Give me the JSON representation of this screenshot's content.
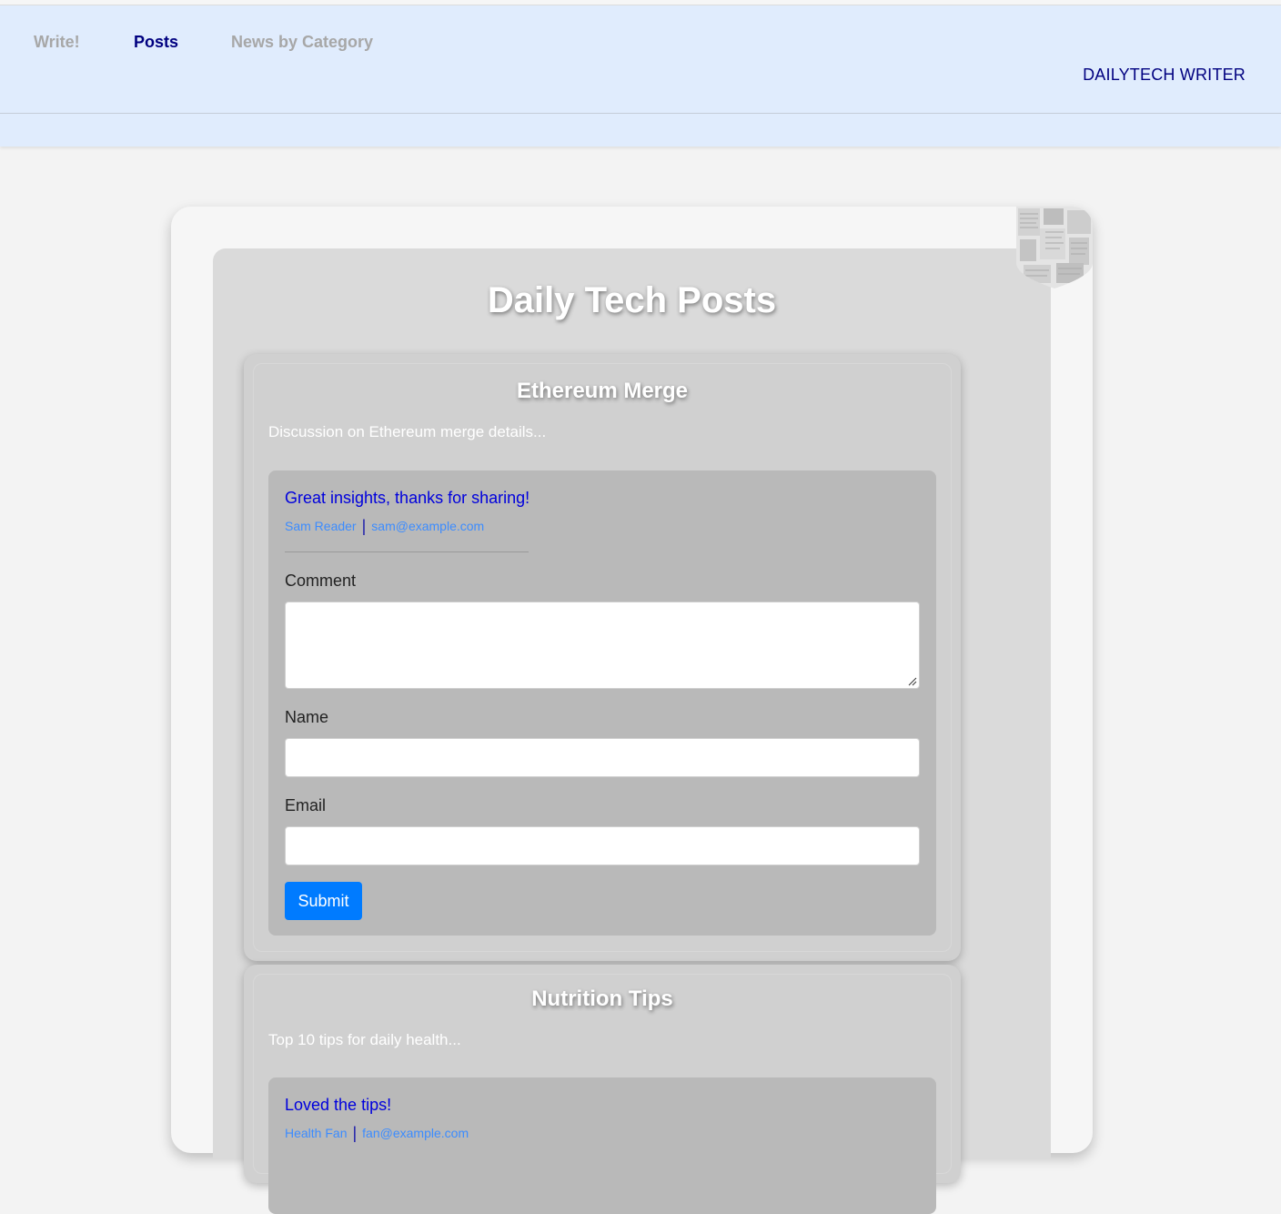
{
  "nav": {
    "links": [
      {
        "label": "Write!",
        "active": false
      },
      {
        "label": "Posts",
        "active": true
      },
      {
        "label": "News by Category",
        "active": false
      }
    ],
    "brand": "DAILYTECH WRITER"
  },
  "page": {
    "title": "Daily Tech Posts"
  },
  "posts": [
    {
      "title": "Ethereum Merge",
      "excerpt": "Discussion on Ethereum merge details...",
      "comment": {
        "text": "Great insights, thanks for sharing!",
        "author": "Sam Reader",
        "email": "sam@example.com"
      },
      "form": {
        "comment_label": "Comment",
        "name_label": "Name",
        "email_label": "Email",
        "submit_label": "Submit"
      }
    },
    {
      "title": "Nutrition Tips",
      "excerpt": "Top 10 tips for daily health...",
      "comment": {
        "text": "Loved the tips!",
        "author": "Health Fan",
        "email": "fan@example.com"
      }
    }
  ],
  "colors": {
    "navbar_bg": "#e0ecfd",
    "nav_active": "#000080",
    "nav_inactive": "#a7a7a7",
    "submit_bg": "#007bff",
    "comment_text": "#0000dd",
    "comment_meta": "#3c8cff"
  }
}
